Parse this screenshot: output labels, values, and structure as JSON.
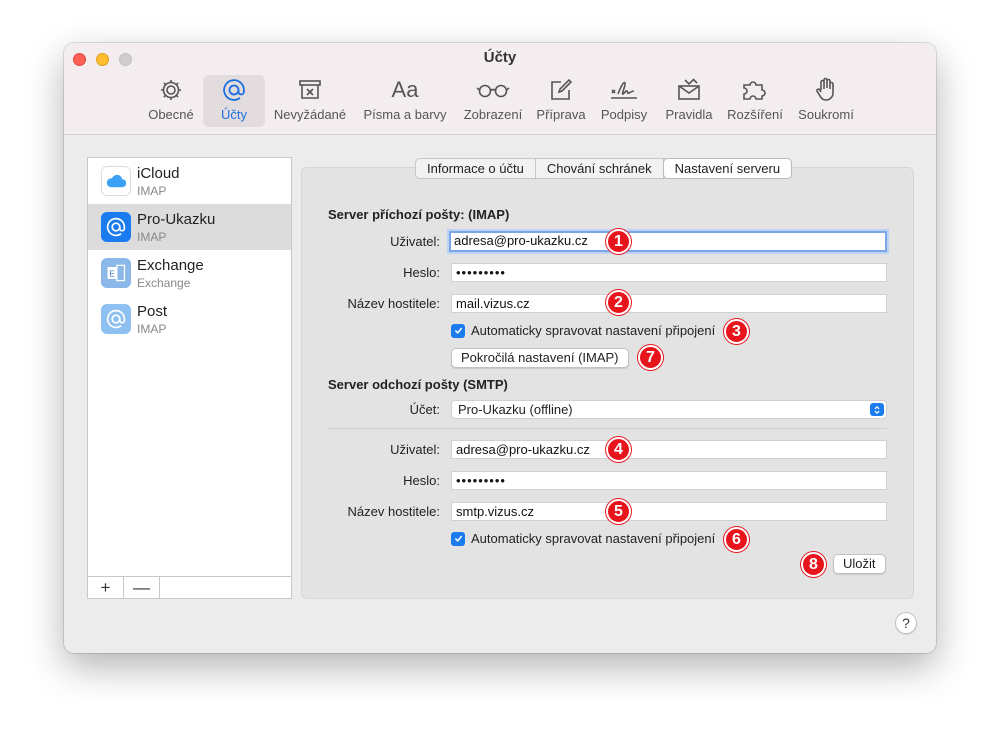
{
  "window": {
    "title": "Účty"
  },
  "toolbar": {
    "items": [
      {
        "label": "Obecné",
        "icon": "gear-icon"
      },
      {
        "label": "Účty",
        "icon": "at-icon"
      },
      {
        "label": "Nevyžádané",
        "icon": "junk-icon"
      },
      {
        "label": "Písma a barvy",
        "icon": "font-icon"
      },
      {
        "label": "Zobrazení",
        "icon": "glasses-icon"
      },
      {
        "label": "Příprava",
        "icon": "compose-icon"
      },
      {
        "label": "Podpisy",
        "icon": "signature-icon"
      },
      {
        "label": "Pravidla",
        "icon": "rules-icon"
      },
      {
        "label": "Rozšíření",
        "icon": "puzzle-icon"
      },
      {
        "label": "Soukromí",
        "icon": "hand-icon"
      }
    ],
    "active": "Účty"
  },
  "accounts": [
    {
      "name": "iCloud",
      "type": "IMAP",
      "icon": "icloud-icon"
    },
    {
      "name": "Pro-Ukazku",
      "type": "IMAP",
      "icon": "at-icon"
    },
    {
      "name": "Exchange",
      "type": "Exchange",
      "icon": "exchange-icon"
    },
    {
      "name": "Post",
      "type": "IMAP",
      "icon": "at-icon"
    }
  ],
  "sidebar_buttons": {
    "add": "+",
    "remove": "—"
  },
  "tabs": [
    "Informace o účtu",
    "Chování schránek",
    "Nastavení serveru"
  ],
  "active_tab": "Nastavení serveru",
  "incoming": {
    "title": "Server příchozí pošty: (IMAP)",
    "user_label": "Uživatel:",
    "user_value": "adresa@pro-ukazku.cz",
    "password_label": "Heslo:",
    "password_value": "•••••••••",
    "host_label": "Název hostitele:",
    "host_value": "mail.vizus.cz",
    "auto_label": "Automaticky spravovat nastavení připojení",
    "advanced_button": "Pokročilá nastavení (IMAP)"
  },
  "outgoing": {
    "title": "Server odchozí pošty (SMTP)",
    "account_label": "Účet:",
    "account_value": "Pro-Ukazku (offline)",
    "user_label": "Uživatel:",
    "user_value": "adresa@pro-ukazku.cz",
    "password_label": "Heslo:",
    "password_value": "•••••••••",
    "host_label": "Název hostitele:",
    "host_value": "smtp.vizus.cz",
    "auto_label": "Automaticky spravovat nastavení připojení"
  },
  "save_button": "Uložit",
  "help_button": "?",
  "markers": [
    "1",
    "2",
    "3",
    "4",
    "5",
    "6",
    "7",
    "8"
  ],
  "colors": {
    "accent": "#1b7cf0",
    "marker": "#e8141c"
  }
}
